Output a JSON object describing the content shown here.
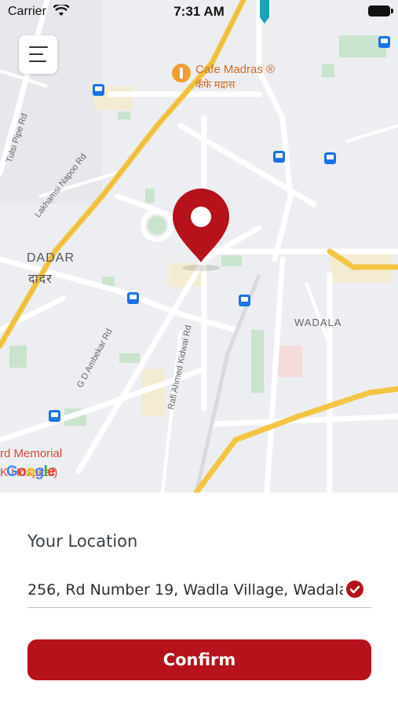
{
  "status_bar": {
    "carrier": "Carrier",
    "time": "7:31 AM"
  },
  "map": {
    "area_labels": {
      "dadar": "DADAR",
      "dadar_native": "दादर",
      "wadala": "WADALA"
    },
    "road_labels": {
      "tulsi_pipe": "Tulsi Pipe Rd",
      "lakhamsi_napoo": "Lakhamsi Napoo Rd",
      "gd_ambekar": "G D Ambekar Rd",
      "rafi_ahmed_kidwai": "Rafi Ahmed Kidwai Rd"
    },
    "poi": {
      "cafe_madras": "Cafe Madras ®",
      "cafe_madras_native": "कॅफे मद्रास",
      "memorial": "rd Memorial",
      "hospital": "K    Hospital)"
    },
    "attribution": "Google",
    "marker_color": "#b5121b"
  },
  "location_panel": {
    "title": "Your Location",
    "address_value": "256, Rd Number 19, Wadla Village, Wadala",
    "confirm_label": "Confirm"
  },
  "colors": {
    "accent": "#b5121b"
  }
}
